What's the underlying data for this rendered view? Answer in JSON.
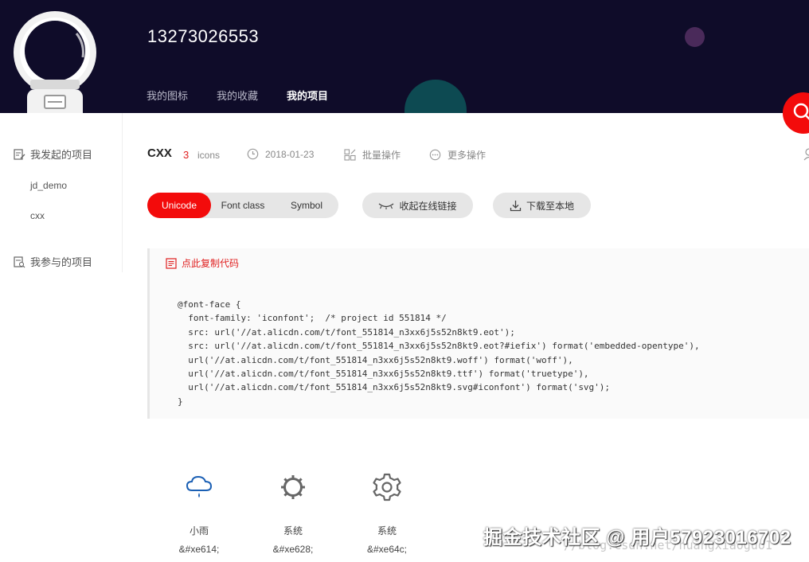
{
  "header": {
    "username": "13273026553",
    "tabs": [
      {
        "label": "我的图标",
        "active": false
      },
      {
        "label": "我的收藏",
        "active": false
      },
      {
        "label": "我的项目",
        "active": true
      }
    ]
  },
  "sidebar": {
    "my_projects_label": "我发起的项目",
    "projects": [
      "jd_demo",
      "cxx"
    ],
    "joined_label": "我参与的项目"
  },
  "project": {
    "name": "CXX",
    "icon_count": "3",
    "icon_unit": "icons",
    "date": "2018-01-23",
    "batch_label": "批量操作",
    "more_label": "更多操作"
  },
  "format_tabs": [
    {
      "label": "Unicode",
      "active": true
    },
    {
      "label": "Font class",
      "active": false
    },
    {
      "label": "Symbol",
      "active": false
    }
  ],
  "actions": {
    "collapse_label": "收起在线链接",
    "download_label": "下载至本地"
  },
  "code_panel": {
    "copy_label": "点此复制代码",
    "code": "@font-face {\n  font-family: 'iconfont';  /* project id 551814 */\n  src: url('//at.alicdn.com/t/font_551814_n3xx6j5s52n8kt9.eot');\n  src: url('//at.alicdn.com/t/font_551814_n3xx6j5s52n8kt9.eot?#iefix') format('embedded-opentype'),\n  url('//at.alicdn.com/t/font_551814_n3xx6j5s52n8kt9.woff') format('woff'),\n  url('//at.alicdn.com/t/font_551814_n3xx6j5s52n8kt9.ttf') format('truetype'),\n  url('//at.alicdn.com/t/font_551814_n3xx6j5s52n8kt9.svg#iconfont') format('svg');\n}"
  },
  "icons": [
    {
      "icon": "cloud-rain-icon",
      "name": "小雨",
      "code": "&#xe614;"
    },
    {
      "icon": "gear-outline-icon",
      "name": "系统",
      "code": "&#xe628;"
    },
    {
      "icon": "gear-icon",
      "name": "系统",
      "code": "&#xe64c;"
    }
  ],
  "watermark": {
    "text": "掘金技术社区 @ 用户57923016702",
    "url": "//blog.csdn.net/huangxiaoguo1"
  },
  "colors": {
    "header_bg": "#0f0c29",
    "accent": "#f30b0b",
    "rain_icon": "#1a5fb4",
    "gear_icon": "#666666"
  }
}
